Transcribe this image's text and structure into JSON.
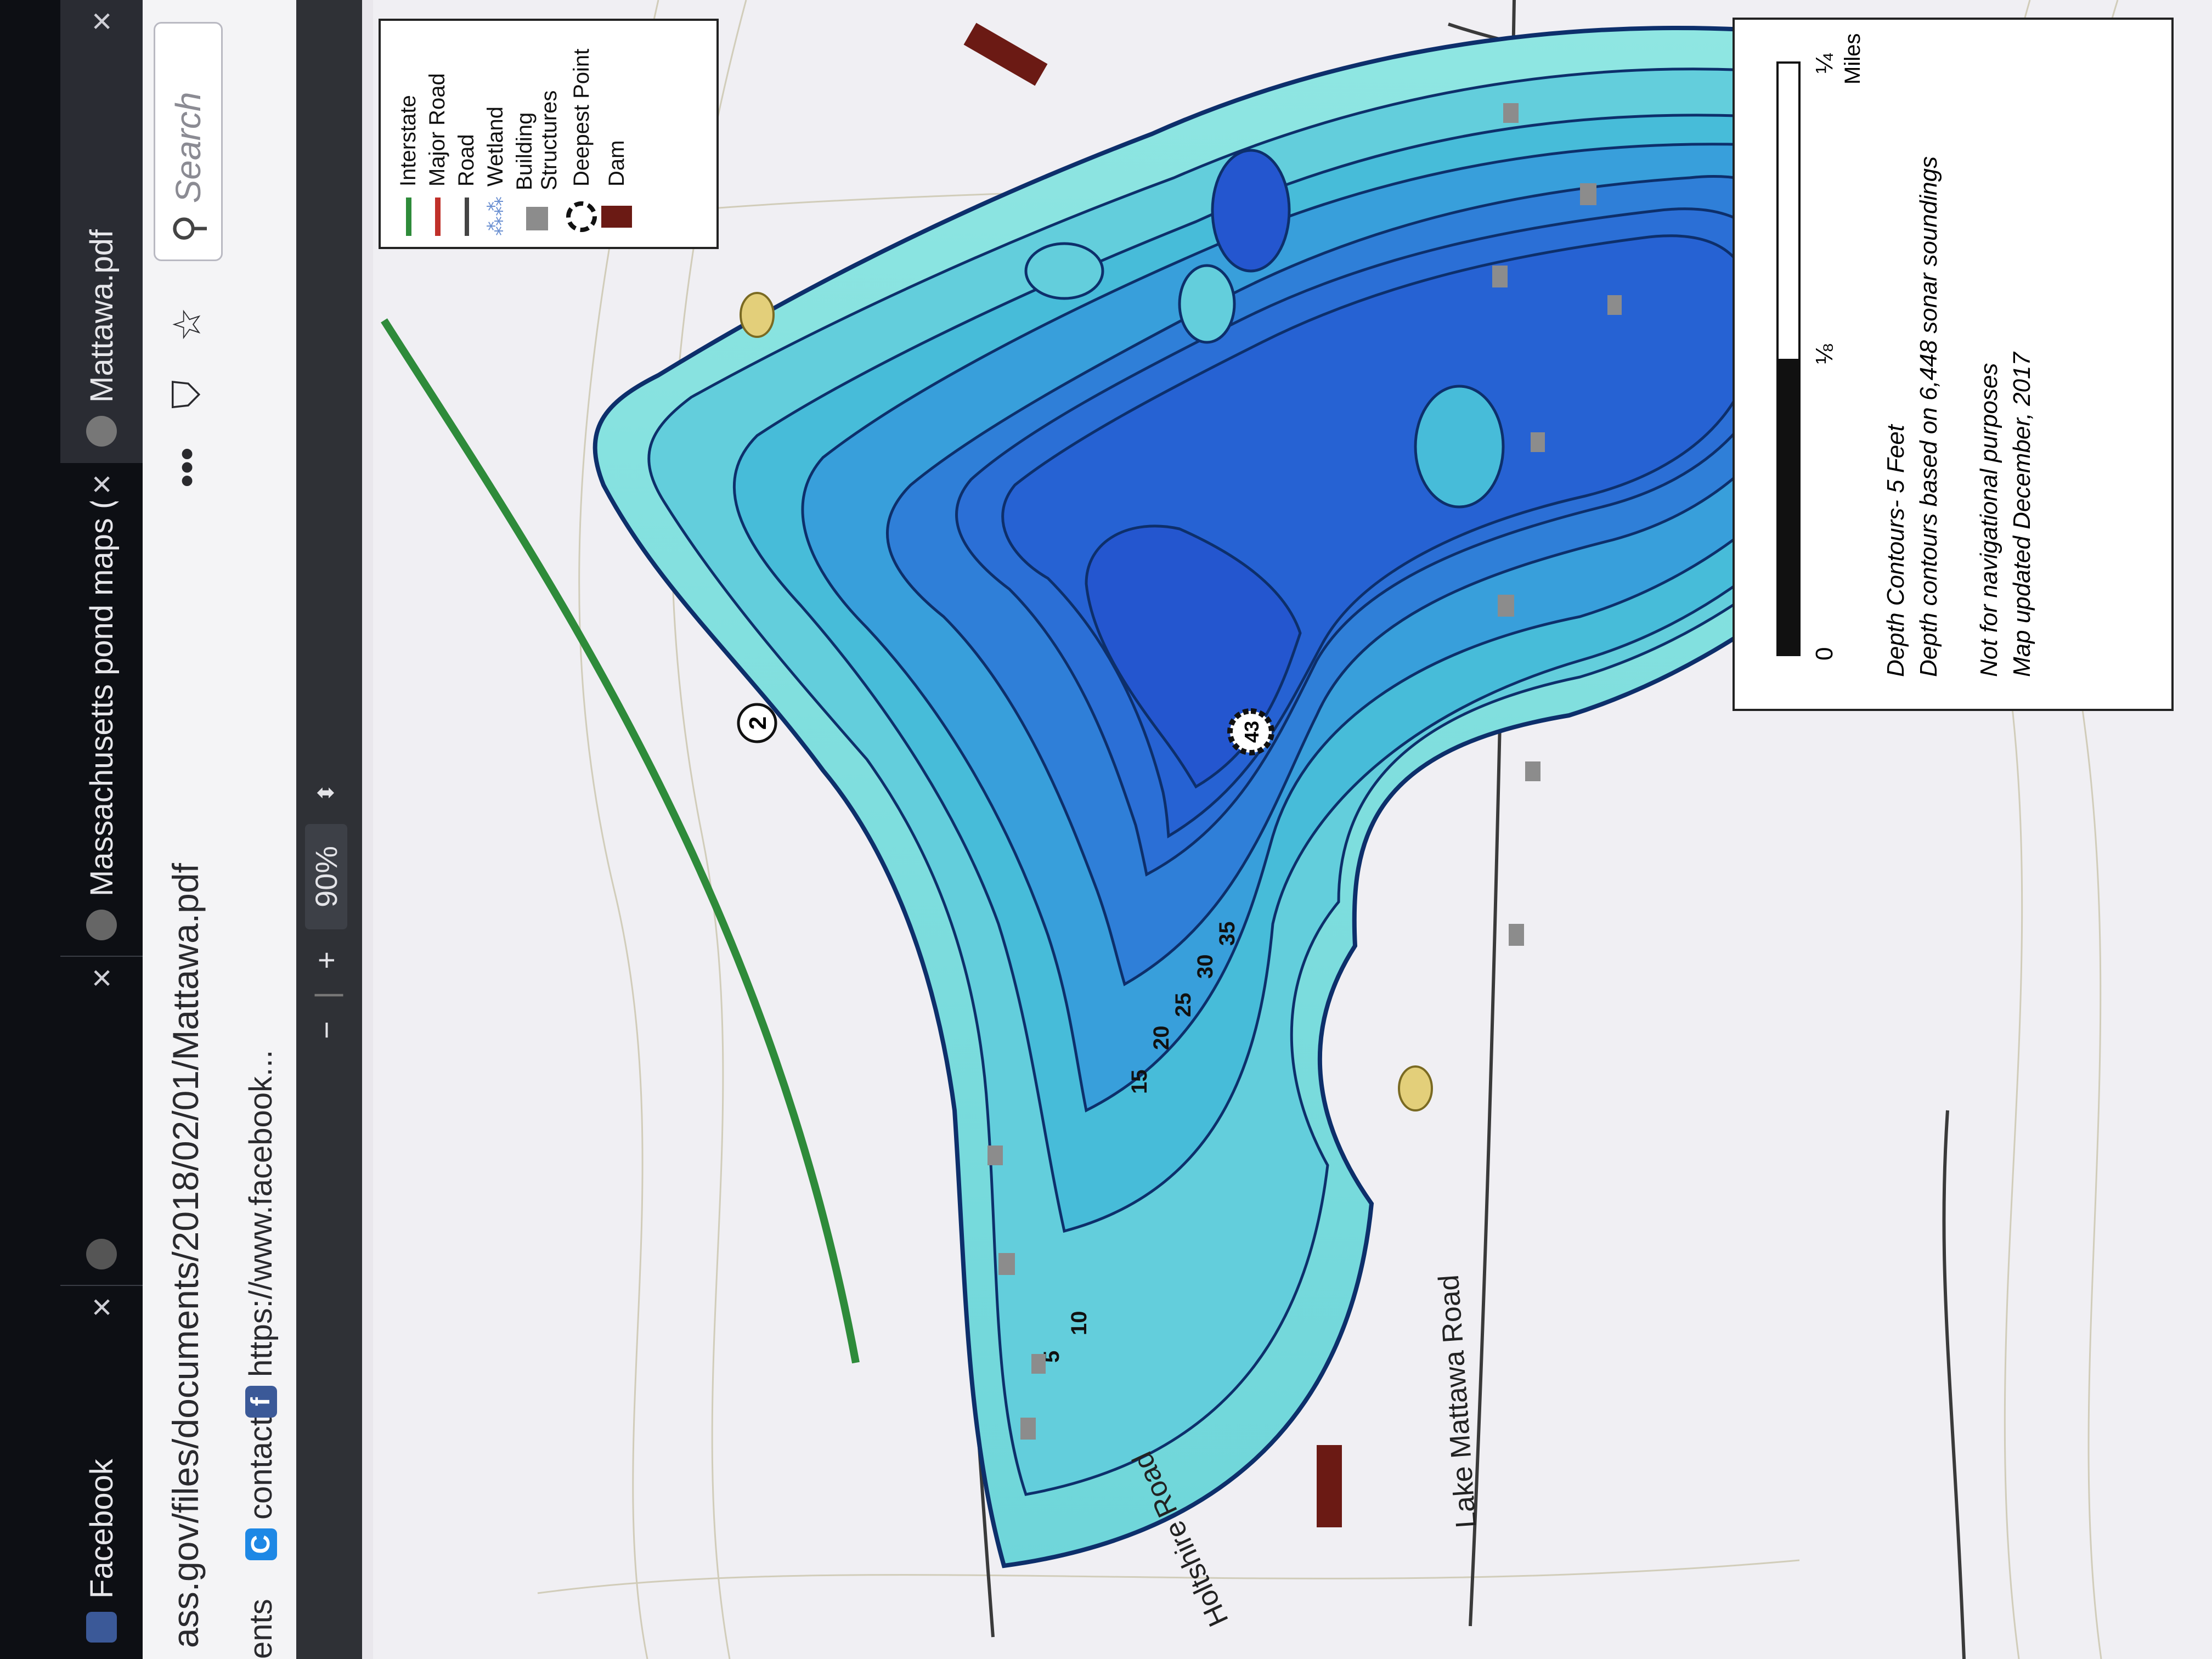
{
  "browser": {
    "tabs": [
      {
        "label": "Facebook",
        "favicon": "facebook-icon",
        "active": false
      },
      {
        "label": "",
        "favicon": "generic-icon",
        "active": false
      },
      {
        "label": "Massachusetts pond maps (sta",
        "favicon": "mass-seal-icon",
        "active": false
      },
      {
        "label": "Mattawa.pdf",
        "favicon": "mass-seal-icon",
        "active": true
      }
    ],
    "close_glyph": "×",
    "url": "ass.gov/files/documents/2018/02/01/Mattawa.pdf",
    "search_placeholder": "Search",
    "bookmarks": [
      {
        "label": "ents",
        "icon": ""
      },
      {
        "label": "contact",
        "icon": "C",
        "color": "#1e88e5"
      },
      {
        "label": "https://www.facebook...",
        "icon": "f",
        "color": "#3b5998"
      }
    ],
    "toolbar_icons": [
      "more-icon",
      "pocket-icon",
      "star-icon"
    ]
  },
  "pdf_toolbar": {
    "zoom_out": "−",
    "zoom_in": "+",
    "zoom_value": "90%"
  },
  "map": {
    "legend": {
      "items": [
        {
          "label": "Interstate",
          "color": "#2e8b3a"
        },
        {
          "label": "Major Road",
          "color": "#c0302a"
        },
        {
          "label": "Road",
          "color": "#444444"
        },
        {
          "label": "Wetland",
          "color": "#6a8fd1"
        },
        {
          "label": "Building Structures",
          "color": "#8c8c8c"
        },
        {
          "label": "Deepest Point",
          "color": "#111111"
        },
        {
          "label": "Dam",
          "color": "#6b1a14"
        }
      ]
    },
    "road_labels": [
      "Lake Mattawa Road",
      "Holtshire Road"
    ],
    "route_shield": "2",
    "deepest_point": "43",
    "depth_labels": [
      "5",
      "10",
      "15",
      "20",
      "25",
      "30",
      "35"
    ],
    "scale": {
      "zero": "0",
      "eighth": "⅛",
      "quarter": "¼",
      "unit": "Miles"
    },
    "notes": [
      "Depth Contours- 5 Feet",
      "Depth contours based on 6,448 sonar soundings",
      "Not for navigational purposes",
      "Map updated December, 2017"
    ],
    "colors": {
      "shallow": "#7fe0df",
      "mid": "#3fb8d8",
      "deep": "#2b6fd6",
      "deepest": "#2456cf",
      "contour": "#0d2f6b"
    }
  }
}
